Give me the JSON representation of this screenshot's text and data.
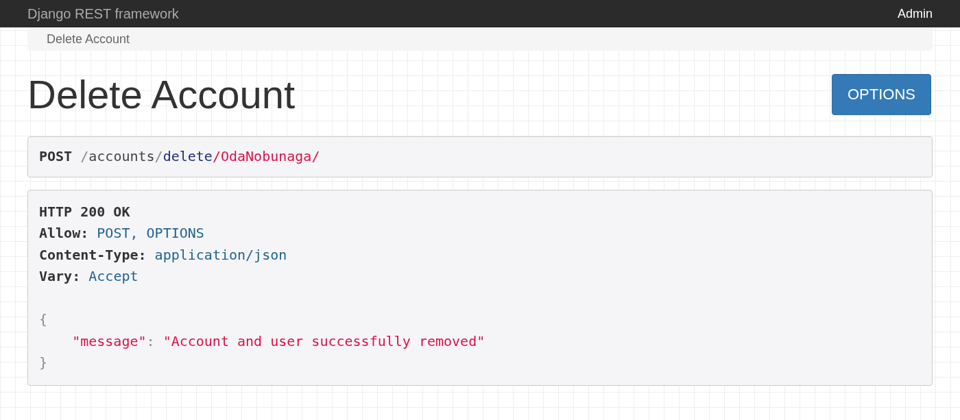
{
  "navbar": {
    "brand": "Django REST framework",
    "user": "Admin"
  },
  "breadcrumb": [
    {
      "label": "Delete Account",
      "selected": true
    }
  ],
  "page_title": "Delete Account",
  "options_button": "OPTIONS",
  "request": {
    "method": "POST",
    "path": [
      {
        "text": "/",
        "kind": "slash"
      },
      {
        "text": "accounts",
        "kind": "segment"
      },
      {
        "text": "/",
        "kind": "slash"
      },
      {
        "text": "delete",
        "kind": "keyword"
      },
      {
        "text": "/OdaNobunaga/",
        "kind": "param"
      }
    ]
  },
  "response": {
    "status": "HTTP 200 OK",
    "headers": [
      {
        "name": "Allow:",
        "value": "POST, OPTIONS"
      },
      {
        "name": "Content-Type:",
        "value": "application/json"
      },
      {
        "name": "Vary:",
        "value": "Accept"
      }
    ],
    "body": [
      {
        "indented": false,
        "tokens": [
          {
            "text": "{",
            "kind": "punct"
          }
        ]
      },
      {
        "indented": true,
        "tokens": [
          {
            "text": "\"message\"",
            "kind": "string"
          },
          {
            "text": ": ",
            "kind": "punct"
          },
          {
            "text": "\"Account and user successfully removed\"",
            "kind": "string"
          }
        ]
      },
      {
        "indented": false,
        "tokens": [
          {
            "text": "}",
            "kind": "punct"
          }
        ]
      }
    ]
  }
}
